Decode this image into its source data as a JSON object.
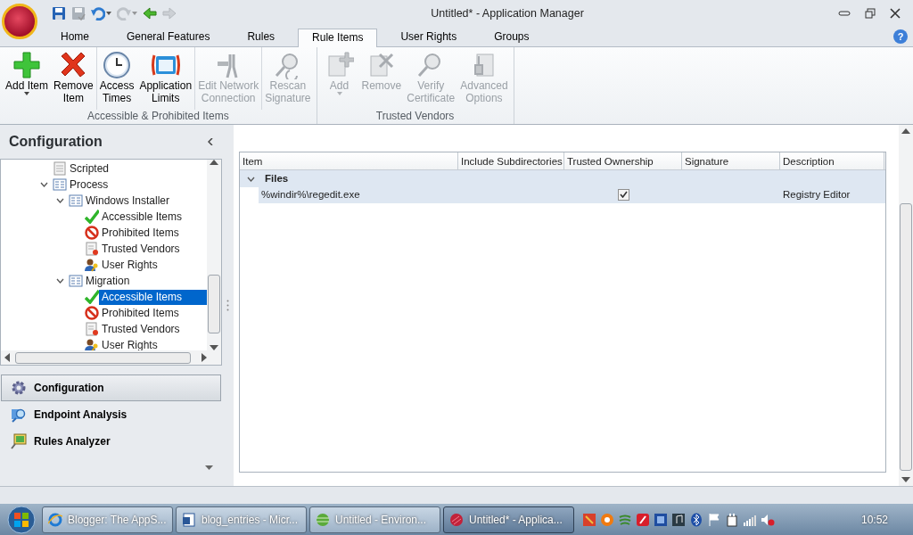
{
  "window": {
    "title": "Untitled* - Application Manager",
    "help": "?"
  },
  "quick_access": [
    {
      "kind": "save",
      "disabled": false,
      "dropdown": false
    },
    {
      "kind": "save-all",
      "disabled": true,
      "dropdown": false
    },
    {
      "kind": "undo",
      "disabled": false,
      "dropdown": true
    },
    {
      "kind": "redo",
      "disabled": true,
      "dropdown": true
    },
    {
      "kind": "back",
      "disabled": false,
      "dropdown": false
    },
    {
      "kind": "forward",
      "disabled": true,
      "dropdown": false
    }
  ],
  "tabs": [
    {
      "label": "Home",
      "selected": false
    },
    {
      "label": "General Features",
      "selected": false
    },
    {
      "label": "Rules",
      "selected": false
    },
    {
      "label": "Rule Items",
      "selected": true
    },
    {
      "label": "User Rights",
      "selected": false
    },
    {
      "label": "Groups",
      "selected": false
    }
  ],
  "ribbon_groups": [
    {
      "label": "Accessible & Prohibited Items",
      "buttons": [
        {
          "kind": "add",
          "label": "Add Item",
          "dropdown": true,
          "disabled": false
        },
        {
          "kind": "remove",
          "label": "Remove\nItem",
          "dropdown": false,
          "disabled": false,
          "separator_after": true
        },
        {
          "kind": "clock",
          "label": "Access\nTimes",
          "dropdown": false,
          "disabled": false
        },
        {
          "kind": "limits",
          "label": "Application\nLimits",
          "dropdown": false,
          "disabled": false,
          "separator_after": true
        },
        {
          "kind": "network",
          "label": "Edit Network\nConnection",
          "dropdown": false,
          "disabled": true,
          "separator_after": true
        },
        {
          "kind": "rescan",
          "label": "Rescan\nSignature",
          "dropdown": false,
          "disabled": true
        }
      ]
    },
    {
      "label": "Trusted Vendors",
      "buttons": [
        {
          "kind": "cert-add",
          "label": "Add",
          "dropdown": true,
          "disabled": true
        },
        {
          "kind": "cert-remove",
          "label": "Remove",
          "dropdown": false,
          "disabled": true
        },
        {
          "kind": "cert-verify",
          "label": "Verify\nCertificate",
          "dropdown": false,
          "disabled": true
        },
        {
          "kind": "cert-options",
          "label": "Advanced\nOptions",
          "dropdown": false,
          "disabled": true
        }
      ]
    }
  ],
  "navigation": {
    "title": "Configuration",
    "tree": [
      {
        "label": "Scripted",
        "kind": "script",
        "selected": false
      },
      {
        "label": "Process",
        "kind": "list",
        "expanded": true,
        "selected": false,
        "children": [
          {
            "label": "Windows Installer",
            "kind": "list",
            "expanded": true,
            "selected": false,
            "children": [
              {
                "label": "Accessible Items",
                "kind": "check",
                "selected": false
              },
              {
                "label": "Prohibited Items",
                "kind": "prohibited",
                "selected": false
              },
              {
                "label": "Trusted Vendors",
                "kind": "vendor",
                "selected": false
              },
              {
                "label": "User Rights",
                "kind": "rights",
                "selected": false
              }
            ]
          },
          {
            "label": "Migration",
            "kind": "list",
            "expanded": true,
            "selected": false,
            "children": [
              {
                "label": "Accessible Items",
                "kind": "check",
                "selected": true
              },
              {
                "label": "Prohibited Items",
                "kind": "prohibited",
                "selected": false
              },
              {
                "label": "Trusted Vendors",
                "kind": "vendor",
                "selected": false
              },
              {
                "label": "User Rights",
                "kind": "rights",
                "selected": false
              }
            ]
          }
        ]
      }
    ],
    "panes": [
      {
        "label": "Configuration",
        "kind": "gear",
        "selected": true
      },
      {
        "label": "Endpoint Analysis",
        "kind": "endpoint",
        "selected": false
      },
      {
        "label": "Rules Analyzer",
        "kind": "analyzer",
        "selected": false
      }
    ]
  },
  "table": {
    "columns": [
      "Item",
      "Include Subdirectories",
      "Trusted Ownership",
      "Signature",
      "Description"
    ],
    "groups": [
      {
        "label": "Files",
        "expanded": true,
        "rows": [
          {
            "item": "%windir%\\regedit.exe",
            "trusted_ownership": true,
            "description": "Registry Editor"
          }
        ]
      }
    ]
  },
  "taskbar": {
    "tasks": [
      {
        "label": "Blogger: The AppS...",
        "kind": "browser",
        "selected": false
      },
      {
        "label": "blog_entries - Micr...",
        "kind": "word",
        "selected": false
      },
      {
        "label": "Untitled - Environ...",
        "kind": "globe",
        "selected": false
      },
      {
        "label": "Untitled* - Applica...",
        "kind": "app",
        "selected": true
      }
    ],
    "clock": "10:52"
  }
}
